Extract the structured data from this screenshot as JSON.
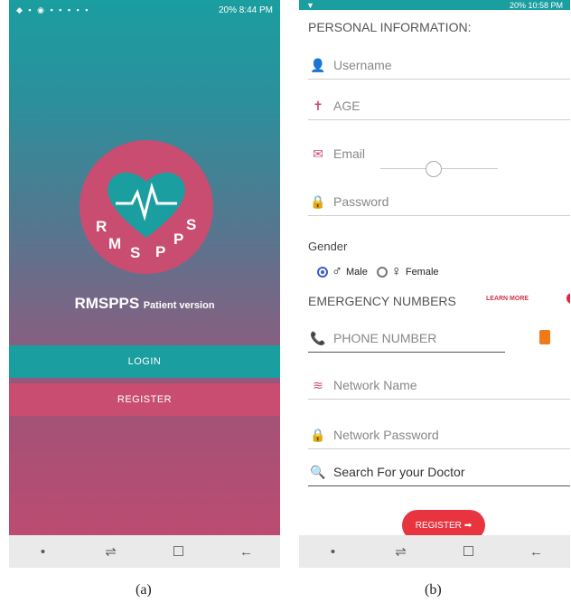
{
  "screen_a": {
    "status_time": "8:44 PM",
    "status_battery": "20%",
    "logo_letters": [
      "R",
      "M",
      "S",
      "P",
      "P",
      "S"
    ],
    "app_name": "RMSPPS",
    "app_subtitle": "Patient version",
    "login_label": "LOGIN",
    "register_label": "REGISTER"
  },
  "screen_b": {
    "status_time": "10:58 PM",
    "status_battery": "20%",
    "personal_title": "PERSONAL INFORMATION:",
    "username_placeholder": "Username",
    "age_placeholder": "AGE",
    "email_placeholder": "Email",
    "password_placeholder": "Password",
    "gender_label": "Gender",
    "male_label": "Male",
    "female_label": "Female",
    "emergency_title": "EMERGENCY NUMBERS",
    "learn_more": "LEARN MORE",
    "phone_placeholder": "PHONE NUMBER",
    "network_name_placeholder": "Network Name",
    "network_password_placeholder": "Network Password",
    "search_doctor_placeholder": "Search For your Doctor",
    "register_label": "REGISTER"
  },
  "captions": {
    "a": "(a)",
    "b": "(b)"
  },
  "colors": {
    "teal": "#1a9ea0",
    "pink": "#c84d70",
    "red": "#e8343f"
  }
}
